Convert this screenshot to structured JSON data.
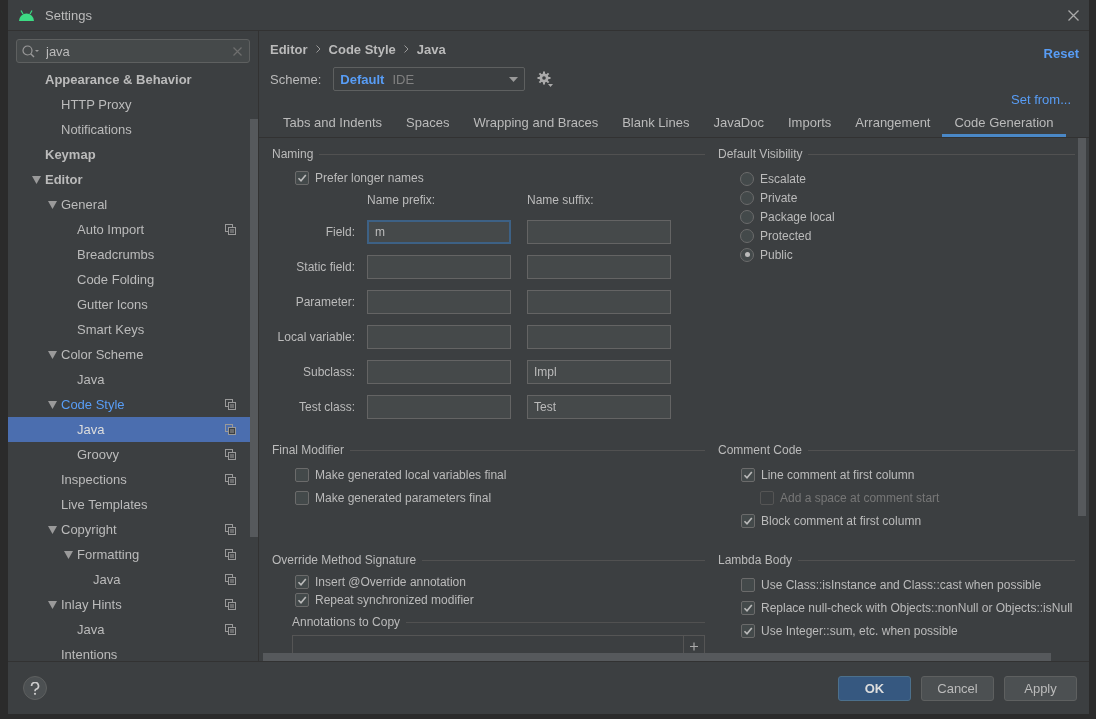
{
  "window": {
    "title": "Settings"
  },
  "sidebar": {
    "search": {
      "value": "java"
    },
    "items": [
      {
        "label": "Appearance & Behavior",
        "selected": false,
        "project_level": false,
        "children": [
          {
            "label": "HTTP Proxy",
            "selected": false,
            "project_level": false
          },
          {
            "label": "Notifications",
            "selected": false,
            "project_level": false
          }
        ]
      },
      {
        "label": "Keymap",
        "selected": false,
        "project_level": false
      },
      {
        "label": "Editor",
        "selected": false,
        "project_level": false,
        "expanded": true,
        "children": [
          {
            "label": "General",
            "selected": false,
            "project_level": false,
            "expanded": true,
            "children": [
              {
                "label": "Auto Import",
                "selected": false,
                "project_level": true
              },
              {
                "label": "Breadcrumbs",
                "selected": false,
                "project_level": false
              },
              {
                "label": "Code Folding",
                "selected": false,
                "project_level": false
              },
              {
                "label": "Gutter Icons",
                "selected": false,
                "project_level": false
              },
              {
                "label": "Smart Keys",
                "selected": false,
                "project_level": false
              }
            ]
          },
          {
            "label": "Color Scheme",
            "selected": false,
            "project_level": false,
            "expanded": true,
            "children": [
              {
                "label": "Java",
                "selected": false,
                "project_level": false
              }
            ]
          },
          {
            "label": "Code Style",
            "selected": false,
            "project_level": true,
            "expanded": true,
            "children": [
              {
                "label": "Java",
                "selected": true,
                "project_level": true
              },
              {
                "label": "Groovy",
                "selected": false,
                "project_level": true
              }
            ]
          },
          {
            "label": "Inspections",
            "selected": false,
            "project_level": true
          },
          {
            "label": "Live Templates",
            "selected": false,
            "project_level": false
          },
          {
            "label": "Copyright",
            "selected": false,
            "project_level": true,
            "expanded": true,
            "children": [
              {
                "label": "Formatting",
                "selected": false,
                "project_level": true,
                "expanded": true,
                "children": [
                  {
                    "label": "Java",
                    "selected": false,
                    "project_level": true
                  }
                ]
              }
            ]
          },
          {
            "label": "Inlay Hints",
            "selected": false,
            "project_level": true,
            "expanded": true,
            "children": [
              {
                "label": "Java",
                "selected": false,
                "project_level": true
              }
            ]
          },
          {
            "label": "Intentions",
            "selected": false,
            "project_level": false
          }
        ]
      }
    ]
  },
  "breadcrumb": [
    "Editor",
    "Code Style",
    "Java"
  ],
  "reset_link": "Reset",
  "scheme": {
    "label": "Scheme:",
    "name": "Default",
    "tag": "IDE"
  },
  "set_from_link": "Set from...",
  "tabs": [
    {
      "label": "Tabs and Indents",
      "selected": false
    },
    {
      "label": "Spaces",
      "selected": false
    },
    {
      "label": "Wrapping and Braces",
      "selected": false
    },
    {
      "label": "Blank Lines",
      "selected": false
    },
    {
      "label": "JavaDoc",
      "selected": false
    },
    {
      "label": "Imports",
      "selected": false
    },
    {
      "label": "Arrangement",
      "selected": false
    },
    {
      "label": "Code Generation",
      "selected": true
    }
  ],
  "naming": {
    "title": "Naming",
    "prefer_longer": {
      "label": "Prefer longer names",
      "checked": true
    },
    "prefix_heading": "Name prefix:",
    "suffix_heading": "Name suffix:",
    "rows": [
      {
        "label": "Field:",
        "prefix": "m",
        "focused": true
      },
      {
        "label": "Static field:",
        "focused": false
      },
      {
        "label": "Parameter:",
        "focused": false
      },
      {
        "label": "Local variable:",
        "focused": false
      },
      {
        "label": "Subclass:",
        "suffix": "Impl",
        "focused": false
      },
      {
        "label": "Test class:",
        "suffix": "Test",
        "focused": false
      }
    ]
  },
  "default_visibility": {
    "title": "Default Visibility",
    "options": [
      {
        "label": "Escalate",
        "selected": false
      },
      {
        "label": "Private",
        "selected": false
      },
      {
        "label": "Package local",
        "selected": false
      },
      {
        "label": "Protected",
        "selected": false
      },
      {
        "label": "Public",
        "selected": true
      }
    ]
  },
  "final_modifier": {
    "title": "Final Modifier",
    "options": [
      {
        "label": "Make generated local variables final",
        "checked": false,
        "disabled": false
      },
      {
        "label": "Make generated parameters final",
        "checked": false,
        "disabled": false
      }
    ]
  },
  "comment_code": {
    "title": "Comment Code",
    "options": [
      {
        "label": "Line comment at first column",
        "checked": true,
        "disabled": false,
        "children": [
          {
            "label": "Add a space at comment start",
            "checked": false,
            "disabled": true
          }
        ]
      },
      {
        "label": "Block comment at first column",
        "checked": true,
        "disabled": false
      }
    ]
  },
  "override_method_signature": {
    "title": "Override Method Signature",
    "options": [
      {
        "label": "Insert @Override annotation",
        "checked": true,
        "disabled": false
      },
      {
        "label": "Repeat synchronized modifier",
        "checked": true,
        "disabled": false
      }
    ],
    "annotations_title": "Annotations to Copy"
  },
  "lambda_body": {
    "title": "Lambda Body",
    "options": [
      {
        "label": "Use Class::isInstance and Class::cast when possible",
        "checked": false,
        "disabled": false
      },
      {
        "label": "Replace null-check with Objects::nonNull or Objects::isNull",
        "checked": true,
        "disabled": false
      },
      {
        "label": "Use Integer::sum, etc. when possible",
        "checked": true,
        "disabled": false
      }
    ]
  },
  "buttons": [
    {
      "label": "OK",
      "kind": "primary"
    },
    {
      "label": "Cancel",
      "kind": "normal"
    },
    {
      "label": "Apply",
      "kind": "normal"
    }
  ]
}
